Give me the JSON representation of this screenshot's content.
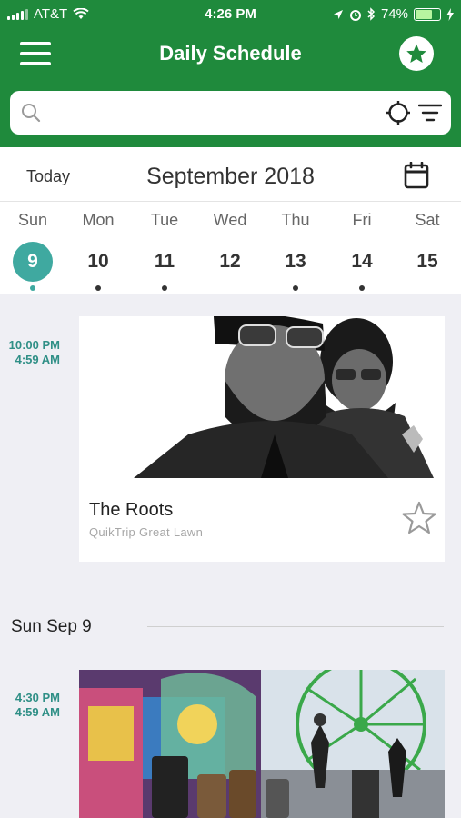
{
  "status_bar": {
    "carrier": "AT&T",
    "time": "4:26 PM",
    "battery": "74%",
    "battery_level": 0.74
  },
  "header": {
    "title": "Daily Schedule"
  },
  "search": {
    "placeholder": ""
  },
  "calendar": {
    "today_label": "Today",
    "month_label": "September 2018",
    "days": [
      {
        "name": "Sun",
        "num": "9",
        "selected": true,
        "has_events": true
      },
      {
        "name": "Mon",
        "num": "10",
        "selected": false,
        "has_events": true
      },
      {
        "name": "Tue",
        "num": "11",
        "selected": false,
        "has_events": true
      },
      {
        "name": "Wed",
        "num": "12",
        "selected": false,
        "has_events": false
      },
      {
        "name": "Thu",
        "num": "13",
        "selected": false,
        "has_events": true
      },
      {
        "name": "Fri",
        "num": "14",
        "selected": false,
        "has_events": true
      },
      {
        "name": "Sat",
        "num": "15",
        "selected": false,
        "has_events": false
      }
    ]
  },
  "events": [
    {
      "start": "10:00 PM",
      "end": "4:59 AM",
      "title": "The Roots",
      "venue": "QuikTrip Great Lawn",
      "image": "band-portrait-photo"
    },
    {
      "start": "4:30 PM",
      "end": "4:59 AM",
      "image": "street-drum-corps-fair-photo"
    }
  ],
  "section": {
    "label": "Sun Sep 9"
  },
  "colors": {
    "brand_green": "#1f8a3c",
    "accent_teal": "#3fa9a0",
    "time_teal": "#2f8f86"
  }
}
